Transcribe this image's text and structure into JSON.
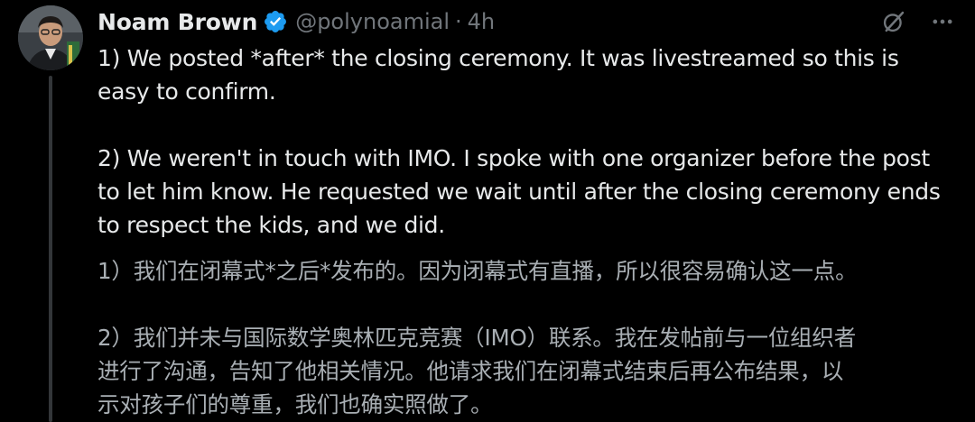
{
  "author": {
    "name": "Noam Brown",
    "handle": "@polynoamial",
    "separator": "·",
    "time": "4h",
    "verified_color": "#1d9bf0"
  },
  "icons": {
    "verified": "verified-badge-icon",
    "grok": "grok-icon",
    "more": "more-icon"
  },
  "tweet": {
    "paragraph1_line1": "1) We posted *after* the closing ceremony. It was livestreamed so this is",
    "paragraph1_line2": "easy to confirm.",
    "paragraph2_line1": "2) We weren't in touch with IMO. I spoke with one organizer before the post",
    "paragraph2_line2": "to let him know. He requested we wait until after the closing ceremony ends",
    "paragraph2_line3": "to respect the kids, and we did."
  },
  "translation": {
    "paragraph1_line1": "1）我们在闭幕式*之后*发布的。因为闭幕式有直播，所以很容易确认这一点。",
    "paragraph2_line1": "2）我们并未与国际数学奥林匹克竞赛（IMO）联系。我在发帖前与一位组织者",
    "paragraph2_line2": "进行了沟通，告知了他相关情况。他请求我们在闭幕式结束后再公布结果，以",
    "paragraph2_line3": "示对孩子们的尊重，我们也确实照做了。"
  }
}
